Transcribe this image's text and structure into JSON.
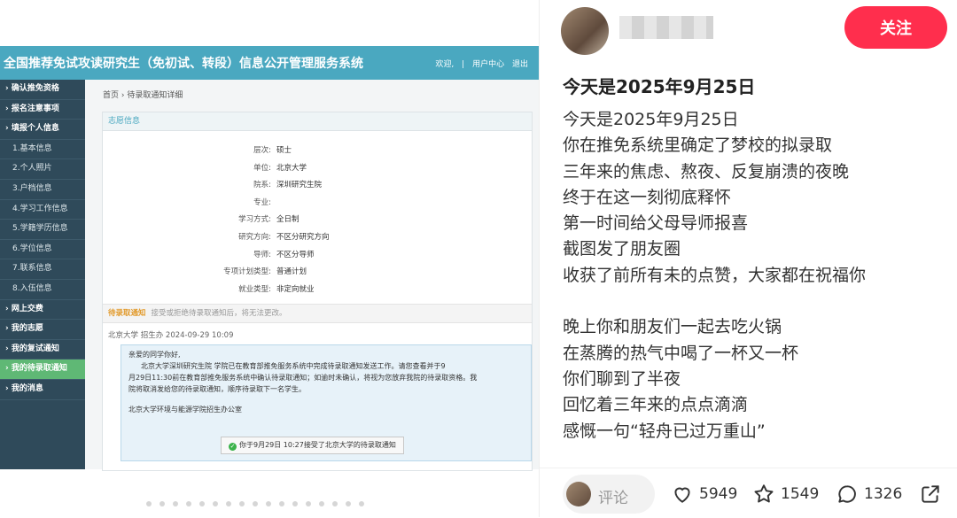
{
  "system": {
    "title": "全国推荐免试攻读研究生（免初试、转段）信息公开管理服务系统",
    "links": [
      "欢迎,",
      "|",
      "用户中心",
      "退出"
    ]
  },
  "sidebar": {
    "items": [
      {
        "label": "确认推免资格",
        "type": "top"
      },
      {
        "label": "报名注意事项",
        "type": "top"
      },
      {
        "label": "填报个人信息",
        "type": "top"
      },
      {
        "label": "1.基本信息",
        "type": "sub"
      },
      {
        "label": "2.个人照片",
        "type": "sub"
      },
      {
        "label": "3.户档信息",
        "type": "sub"
      },
      {
        "label": "4.学习工作信息",
        "type": "sub"
      },
      {
        "label": "5.学籍学历信息",
        "type": "sub"
      },
      {
        "label": "6.学位信息",
        "type": "sub"
      },
      {
        "label": "7.联系信息",
        "type": "sub"
      },
      {
        "label": "8.入伍信息",
        "type": "sub"
      },
      {
        "label": "网上交费",
        "type": "top"
      },
      {
        "label": "我的志愿",
        "type": "top"
      },
      {
        "label": "我的复试通知",
        "type": "top"
      },
      {
        "label": "我的待录取通知",
        "type": "active"
      },
      {
        "label": "我的消息",
        "type": "top"
      }
    ]
  },
  "breadcrumb": {
    "home": "首页",
    "sep": "›",
    "current": "待录取通知详细"
  },
  "volunteer": {
    "section_title": "志愿信息",
    "rows": [
      {
        "k": "层次:",
        "v": "硕士"
      },
      {
        "k": "单位:",
        "v": "北京大学"
      },
      {
        "k": "院系:",
        "v": "深圳研究生院"
      },
      {
        "k": "专业:",
        "v": ""
      },
      {
        "k": "学习方式:",
        "v": "全日制"
      },
      {
        "k": "研究方向:",
        "v": "不区分研究方向"
      },
      {
        "k": "导师:",
        "v": "不区分导师"
      },
      {
        "k": "专项计划类型:",
        "v": "普通计划"
      },
      {
        "k": "就业类型:",
        "v": "非定向就业"
      }
    ]
  },
  "notice": {
    "section_title": "待录取通知",
    "section_desc": "接受或拒绝待录取通知后，将无法更改。",
    "from": "北京大学 招生办 2024-09-29 10:09",
    "greeting": "亲爱的同学你好,",
    "body1": "北京大学深圳研究生院            学院已在教育部推免服务系统中完成待录取通知发送工作。请您查看并于9",
    "body2": "月29日11:30前在教育部推免服务系统中确认待录取通知；如逾时未确认，将视为您放弃我院的待录取资格。我",
    "body3": "院将取消发给您的待录取通知，顺序待录取下一名学生。",
    "sign": "北京大学环境与能源学院招生办公室",
    "accepted": "你于9月29日 10:27接受了北京大学的待录取通知"
  },
  "post": {
    "follow_label": "关注",
    "title": "今天是2025年9月25日",
    "lines": [
      "今天是2025年9月25日",
      "你在推免系统里确定了梦校的拟录取",
      "三年来的焦虑、熬夜、反复崩溃的夜晚",
      "终于在这一刻彻底释怀",
      "第一时间给父母导师报喜",
      "截图发了朋友圈",
      "收获了前所有未的点赞，大家都在祝福你",
      "",
      "晚上你和朋友们一起去吃火锅",
      "在蒸腾的热气中喝了一杯又一杯",
      "你们聊到了半夜",
      "回忆着三年来的点点滴滴",
      "感慨一句“轻舟已过万重山”"
    ]
  },
  "bottom": {
    "comment_placeholder": "评论",
    "likes": "5949",
    "stars": "1549",
    "comments": "1326"
  },
  "colors": {
    "accent": "#ff2e4d",
    "header": "#4aa8c0",
    "sidebar": "#2f4a5a",
    "active": "#5fb875"
  },
  "carousel": {
    "count": 18,
    "active_index": 0
  }
}
